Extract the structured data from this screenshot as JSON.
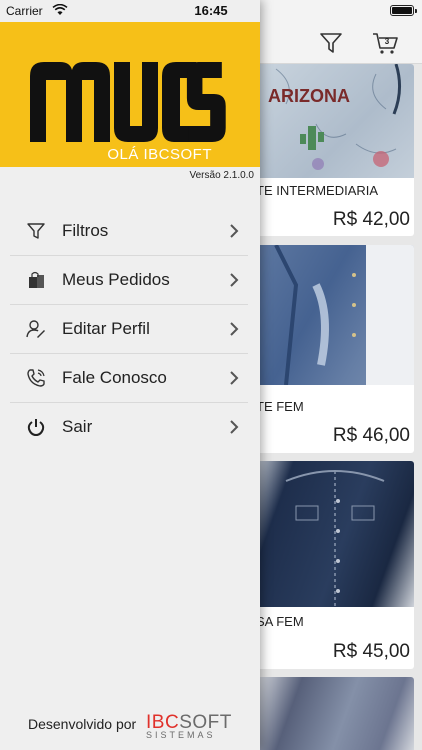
{
  "status_bar": {
    "carrier": "Carrier",
    "time": "16:45"
  },
  "drawer": {
    "greeting": "OLÁ IBCSOFT",
    "version": "Versão 2.1.0.0",
    "menu": [
      {
        "label": "Filtros",
        "icon": "filter-icon"
      },
      {
        "label": "Meus Pedidos",
        "icon": "shopping-bag-icon"
      },
      {
        "label": "Editar Perfil",
        "icon": "user-edit-icon"
      },
      {
        "label": "Fale Conosco",
        "icon": "phone-icon"
      },
      {
        "label": "Sair",
        "icon": "power-icon"
      }
    ],
    "footer": {
      "text": "Desenvolvido por",
      "brand_red": "IBC",
      "brand_gray": "SOFT",
      "brand_sub": "SISTEMAS"
    }
  },
  "app": {
    "cart_count": "3",
    "products": [
      {
        "name": "TE INTERMEDIARIA",
        "price": "R$ 42,00",
        "image_text": "ARIZONA"
      },
      {
        "name": "TE FEM",
        "price": "R$ 46,00"
      },
      {
        "name": "SA FEM",
        "price": "R$ 45,00"
      },
      {
        "name": "",
        "price": ""
      }
    ]
  },
  "colors": {
    "brand_yellow": "#f6c018",
    "brand_red": "#e0312b"
  }
}
